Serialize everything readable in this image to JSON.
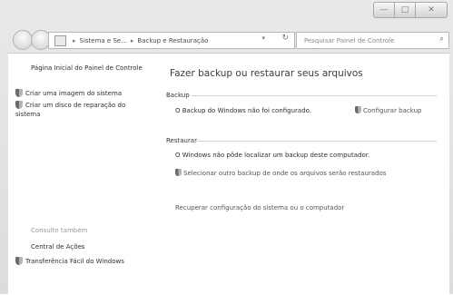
{
  "window": {
    "minimize_label": "—",
    "maximize_label": "□",
    "close_label": "✕"
  },
  "navbar": {
    "breadcrumb_1": "Sistema e Se...",
    "breadcrumb_2": "Backup e Restauração",
    "search_placeholder": "Pesquisar Painel de Controle"
  },
  "sidebar": {
    "home_link": "Página Inicial do Painel de Controle",
    "tasks": [
      {
        "label": "Criar uma imagem do sistema",
        "icon": "shield-icon"
      },
      {
        "label": "Criar um disco de reparação do sistema",
        "icon": "shield-icon"
      }
    ],
    "see_also_header": "Consulte também",
    "see_also": [
      {
        "label": "Central de Ações"
      },
      {
        "label": "Transferência Fácil do Windows",
        "icon": "shield-icon"
      }
    ]
  },
  "main": {
    "title": "Fazer backup ou restaurar seus arquivos",
    "backup_section": {
      "header": "Backup",
      "status": "O Backup do Windows não foi configurado.",
      "configure_link": "Configurar backup"
    },
    "restore_section": {
      "header": "Restaurar",
      "status": "O Windows não pôde localizar um backup deste computador.",
      "select_link": "Selecionar outro backup de onde os arquivos serão restaurados",
      "recover_link": "Recuperar configuração do sistema ou o computador"
    }
  }
}
